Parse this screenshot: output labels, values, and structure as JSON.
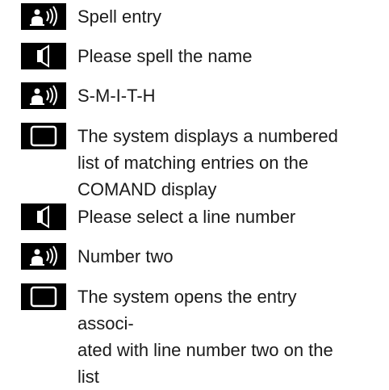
{
  "steps": [
    {
      "icon": "voice-command-icon",
      "text": "Spell entry"
    },
    {
      "icon": "speaker-icon",
      "text": "Please spell the name"
    },
    {
      "icon": "voice-command-icon",
      "text": "S-M-I-T-H"
    },
    {
      "icon": "display-icon",
      "text": "The system displays a numbered\nlist of matching entries on the\nCOMAND display"
    },
    {
      "icon": "speaker-icon",
      "text": "Please select a line number"
    },
    {
      "icon": "voice-command-icon",
      "text": "Number two"
    },
    {
      "icon": "display-icon",
      "text": "The system opens the entry associ-\nated with line number two on the\nlist"
    }
  ]
}
